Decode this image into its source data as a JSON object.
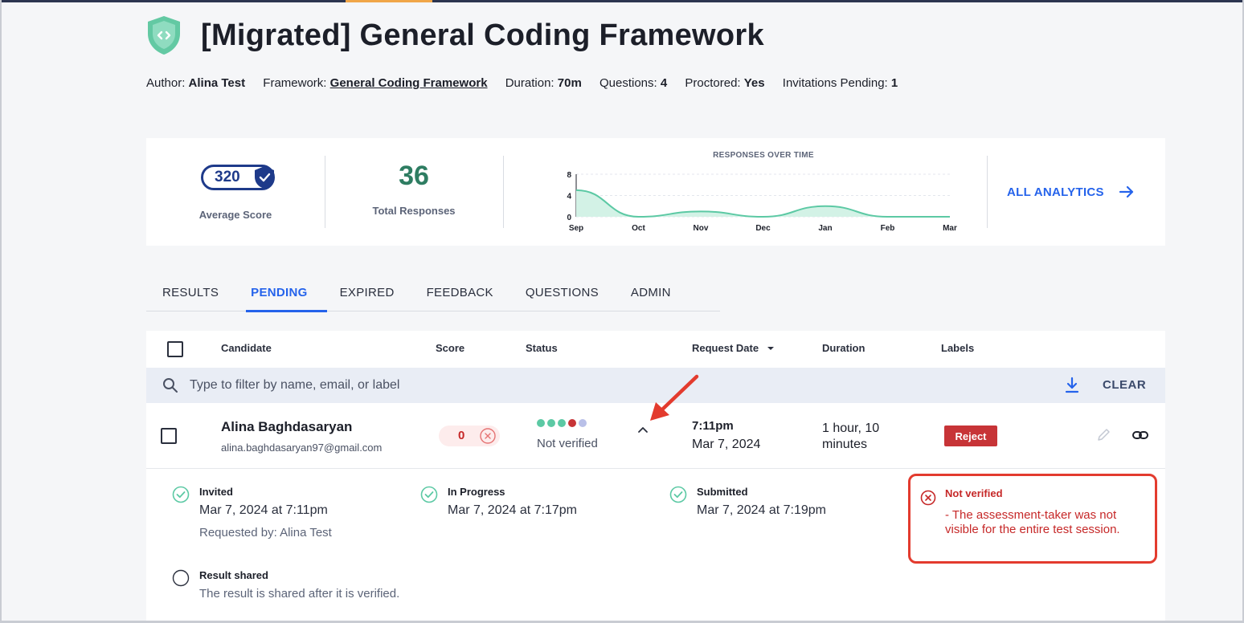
{
  "assessment": {
    "title": "[Migrated] General Coding Framework",
    "meta": {
      "author_label": "Author:",
      "author": "Alina Test",
      "framework_label": "Framework:",
      "framework": "General Coding Framework",
      "duration_label": "Duration:",
      "duration": "70m",
      "questions_label": "Questions:",
      "questions": "4",
      "proctored_label": "Proctored:",
      "proctored": "Yes",
      "invitations_label": "Invitations Pending:",
      "invitations": "1"
    }
  },
  "stats": {
    "average_score": "320",
    "average_score_label": "Average Score",
    "total_responses": "36",
    "total_responses_label": "Total Responses",
    "all_analytics": "ALL ANALYTICS"
  },
  "chart_data": {
    "type": "area",
    "title": "RESPONSES OVER TIME",
    "categories": [
      "Sep",
      "Oct",
      "Nov",
      "Dec",
      "Jan",
      "Feb",
      "Mar"
    ],
    "values": [
      5,
      0,
      1,
      0,
      2,
      0,
      0
    ],
    "y_ticks": [
      "8",
      "4",
      "0"
    ],
    "ylim": [
      0,
      8
    ],
    "grid": true,
    "colors": {
      "line": "#5cc9a4",
      "fill": "#d3f2e6"
    }
  },
  "tabs": [
    {
      "label": "RESULTS",
      "active": false
    },
    {
      "label": "PENDING",
      "active": true
    },
    {
      "label": "EXPIRED",
      "active": false
    },
    {
      "label": "FEEDBACK",
      "active": false
    },
    {
      "label": "QUESTIONS",
      "active": false
    },
    {
      "label": "ADMIN",
      "active": false
    }
  ],
  "table": {
    "headers": {
      "candidate": "Candidate",
      "score": "Score",
      "status": "Status",
      "request_date": "Request Date",
      "duration": "Duration",
      "labels": "Labels"
    },
    "filter_placeholder": "Type to filter by name, email, or label",
    "clear": "CLEAR",
    "rows": [
      {
        "name": "Alina Baghdasaryan",
        "email": "alina.baghdasaryan97@gmail.com",
        "score": "0",
        "status_dots": [
          "#5cc9a4",
          "#5cc9a4",
          "#5cc9a4",
          "#c73437",
          "#b9c0e8"
        ],
        "status": "Not verified",
        "request_time": "7:11pm",
        "request_date": "Mar 7, 2024",
        "duration": "1 hour, 10 minutes",
        "label": "Reject"
      }
    ]
  },
  "details": {
    "invited": {
      "title": "Invited",
      "date": "Mar 7, 2024 at 7:11pm",
      "sub": "Requested by: Alina Test"
    },
    "in_progress": {
      "title": "In Progress",
      "date": "Mar 7, 2024 at 7:17pm"
    },
    "submitted": {
      "title": "Submitted",
      "date": "Mar 7, 2024 at 7:19pm"
    },
    "result_shared": {
      "title": "Result shared",
      "note": "The result is shared after it is verified."
    },
    "not_verified": {
      "title": "Not verified",
      "text": "- The assessment-taker was not visible for the entire test session."
    }
  },
  "colors": {
    "accent": "#2563eb",
    "success": "#5cc9a4",
    "danger": "#c62828",
    "highlight_box": "#e33b2e"
  }
}
